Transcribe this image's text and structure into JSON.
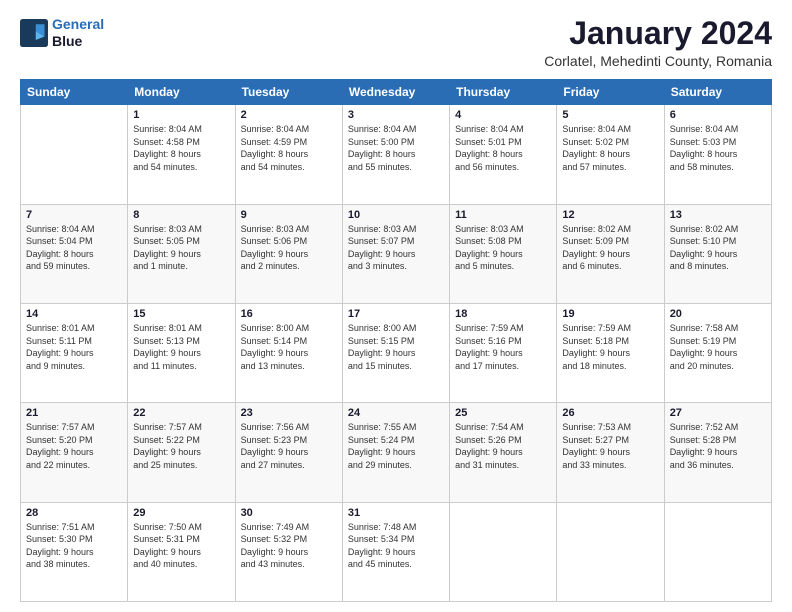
{
  "logo": {
    "line1": "General",
    "line2": "Blue"
  },
  "title": "January 2024",
  "subtitle": "Corlatel, Mehedinti County, Romania",
  "weekdays": [
    "Sunday",
    "Monday",
    "Tuesday",
    "Wednesday",
    "Thursday",
    "Friday",
    "Saturday"
  ],
  "weeks": [
    [
      {
        "day": "",
        "info": ""
      },
      {
        "day": "1",
        "info": "Sunrise: 8:04 AM\nSunset: 4:58 PM\nDaylight: 8 hours\nand 54 minutes."
      },
      {
        "day": "2",
        "info": "Sunrise: 8:04 AM\nSunset: 4:59 PM\nDaylight: 8 hours\nand 54 minutes."
      },
      {
        "day": "3",
        "info": "Sunrise: 8:04 AM\nSunset: 5:00 PM\nDaylight: 8 hours\nand 55 minutes."
      },
      {
        "day": "4",
        "info": "Sunrise: 8:04 AM\nSunset: 5:01 PM\nDaylight: 8 hours\nand 56 minutes."
      },
      {
        "day": "5",
        "info": "Sunrise: 8:04 AM\nSunset: 5:02 PM\nDaylight: 8 hours\nand 57 minutes."
      },
      {
        "day": "6",
        "info": "Sunrise: 8:04 AM\nSunset: 5:03 PM\nDaylight: 8 hours\nand 58 minutes."
      }
    ],
    [
      {
        "day": "7",
        "info": "Sunrise: 8:04 AM\nSunset: 5:04 PM\nDaylight: 8 hours\nand 59 minutes."
      },
      {
        "day": "8",
        "info": "Sunrise: 8:03 AM\nSunset: 5:05 PM\nDaylight: 9 hours\nand 1 minute."
      },
      {
        "day": "9",
        "info": "Sunrise: 8:03 AM\nSunset: 5:06 PM\nDaylight: 9 hours\nand 2 minutes."
      },
      {
        "day": "10",
        "info": "Sunrise: 8:03 AM\nSunset: 5:07 PM\nDaylight: 9 hours\nand 3 minutes."
      },
      {
        "day": "11",
        "info": "Sunrise: 8:03 AM\nSunset: 5:08 PM\nDaylight: 9 hours\nand 5 minutes."
      },
      {
        "day": "12",
        "info": "Sunrise: 8:02 AM\nSunset: 5:09 PM\nDaylight: 9 hours\nand 6 minutes."
      },
      {
        "day": "13",
        "info": "Sunrise: 8:02 AM\nSunset: 5:10 PM\nDaylight: 9 hours\nand 8 minutes."
      }
    ],
    [
      {
        "day": "14",
        "info": "Sunrise: 8:01 AM\nSunset: 5:11 PM\nDaylight: 9 hours\nand 9 minutes."
      },
      {
        "day": "15",
        "info": "Sunrise: 8:01 AM\nSunset: 5:13 PM\nDaylight: 9 hours\nand 11 minutes."
      },
      {
        "day": "16",
        "info": "Sunrise: 8:00 AM\nSunset: 5:14 PM\nDaylight: 9 hours\nand 13 minutes."
      },
      {
        "day": "17",
        "info": "Sunrise: 8:00 AM\nSunset: 5:15 PM\nDaylight: 9 hours\nand 15 minutes."
      },
      {
        "day": "18",
        "info": "Sunrise: 7:59 AM\nSunset: 5:16 PM\nDaylight: 9 hours\nand 17 minutes."
      },
      {
        "day": "19",
        "info": "Sunrise: 7:59 AM\nSunset: 5:18 PM\nDaylight: 9 hours\nand 18 minutes."
      },
      {
        "day": "20",
        "info": "Sunrise: 7:58 AM\nSunset: 5:19 PM\nDaylight: 9 hours\nand 20 minutes."
      }
    ],
    [
      {
        "day": "21",
        "info": "Sunrise: 7:57 AM\nSunset: 5:20 PM\nDaylight: 9 hours\nand 22 minutes."
      },
      {
        "day": "22",
        "info": "Sunrise: 7:57 AM\nSunset: 5:22 PM\nDaylight: 9 hours\nand 25 minutes."
      },
      {
        "day": "23",
        "info": "Sunrise: 7:56 AM\nSunset: 5:23 PM\nDaylight: 9 hours\nand 27 minutes."
      },
      {
        "day": "24",
        "info": "Sunrise: 7:55 AM\nSunset: 5:24 PM\nDaylight: 9 hours\nand 29 minutes."
      },
      {
        "day": "25",
        "info": "Sunrise: 7:54 AM\nSunset: 5:26 PM\nDaylight: 9 hours\nand 31 minutes."
      },
      {
        "day": "26",
        "info": "Sunrise: 7:53 AM\nSunset: 5:27 PM\nDaylight: 9 hours\nand 33 minutes."
      },
      {
        "day": "27",
        "info": "Sunrise: 7:52 AM\nSunset: 5:28 PM\nDaylight: 9 hours\nand 36 minutes."
      }
    ],
    [
      {
        "day": "28",
        "info": "Sunrise: 7:51 AM\nSunset: 5:30 PM\nDaylight: 9 hours\nand 38 minutes."
      },
      {
        "day": "29",
        "info": "Sunrise: 7:50 AM\nSunset: 5:31 PM\nDaylight: 9 hours\nand 40 minutes."
      },
      {
        "day": "30",
        "info": "Sunrise: 7:49 AM\nSunset: 5:32 PM\nDaylight: 9 hours\nand 43 minutes."
      },
      {
        "day": "31",
        "info": "Sunrise: 7:48 AM\nSunset: 5:34 PM\nDaylight: 9 hours\nand 45 minutes."
      },
      {
        "day": "",
        "info": ""
      },
      {
        "day": "",
        "info": ""
      },
      {
        "day": "",
        "info": ""
      }
    ]
  ]
}
